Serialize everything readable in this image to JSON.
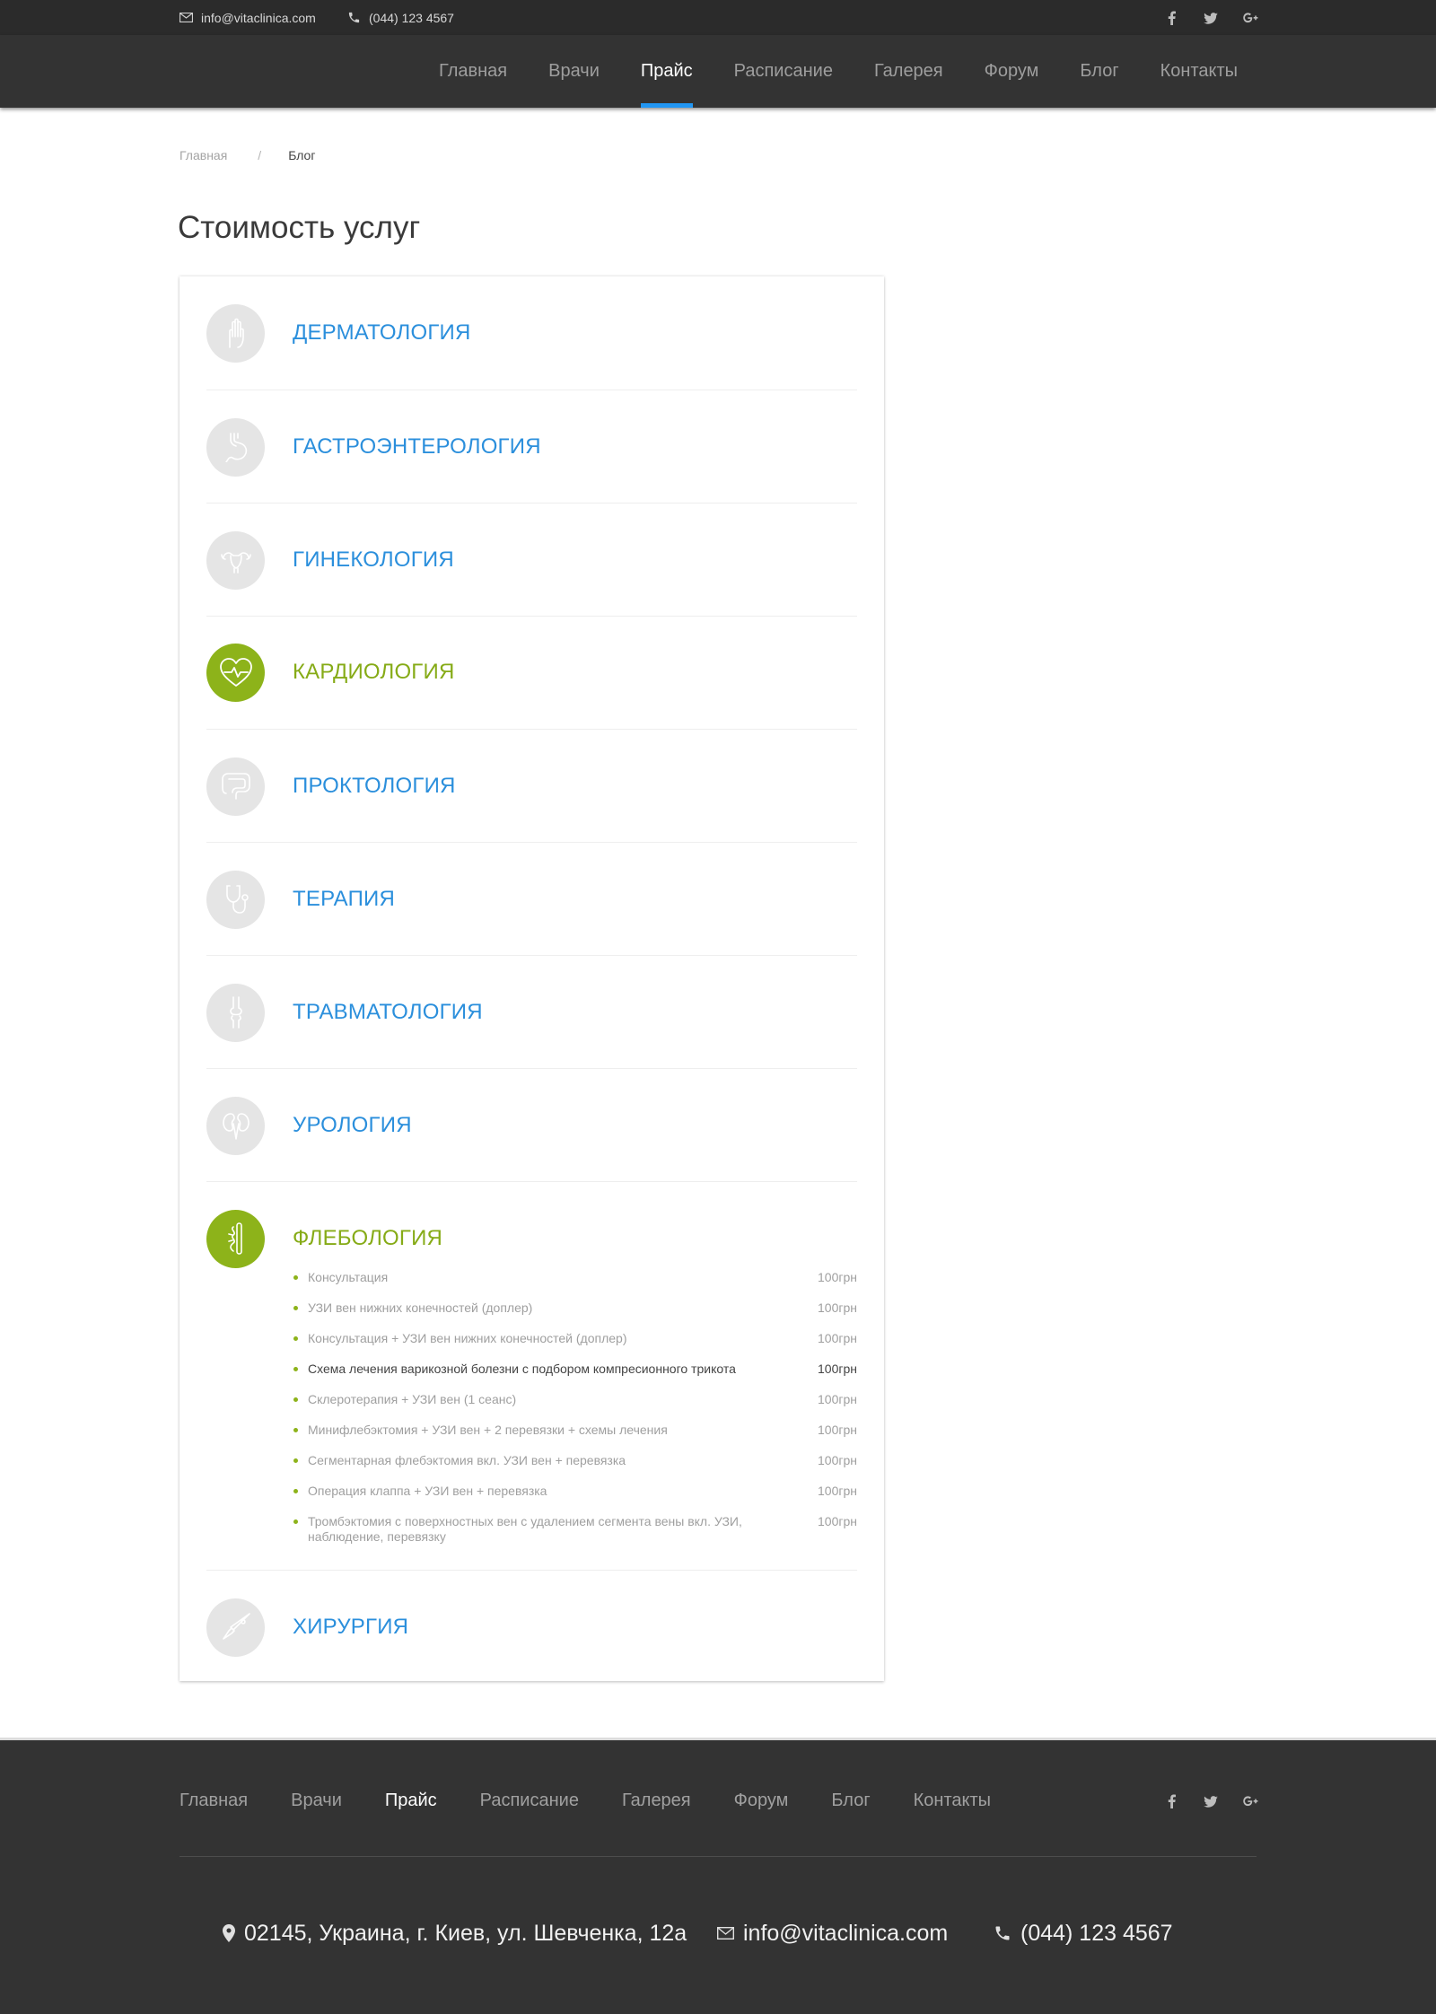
{
  "topbar": {
    "email": "info@vitaclinica.com",
    "phone": "(044) 123 4567",
    "social": [
      "facebook-icon",
      "twitter-icon",
      "google-plus-icon"
    ]
  },
  "nav": {
    "items": [
      {
        "label": "Главная"
      },
      {
        "label": "Врачи"
      },
      {
        "label": "Прайс",
        "active": true
      },
      {
        "label": "Расписание"
      },
      {
        "label": "Галерея"
      },
      {
        "label": "Форум"
      },
      {
        "label": "Блог"
      },
      {
        "label": "Контакты"
      }
    ]
  },
  "breadcrumb": {
    "home": "Главная",
    "separator": "/",
    "current": "Блог"
  },
  "page_title": "Стоимость услуг",
  "categories": [
    {
      "title": "ДЕРМАТОЛОГИЯ",
      "icon": "hand-icon"
    },
    {
      "title": "ГАСТРОЭНТЕРОЛОГИЯ",
      "icon": "stomach-icon"
    },
    {
      "title": "ГИНЕКОЛОГИЯ",
      "icon": "uterus-icon"
    },
    {
      "title": "КАРДИОЛОГИЯ",
      "icon": "heart-pulse-icon",
      "active": true
    },
    {
      "title": "ПРОКТОЛОГИЯ",
      "icon": "intestine-icon"
    },
    {
      "title": "ТЕРАПИЯ",
      "icon": "stethoscope-icon"
    },
    {
      "title": "ТРАВМАТОЛОГИЯ",
      "icon": "bone-joint-icon"
    },
    {
      "title": "УРОЛОГИЯ",
      "icon": "kidneys-icon"
    },
    {
      "title": "ФЛЕБОЛОГИЯ",
      "icon": "vein-icon",
      "active": true
    },
    {
      "title": "ХИРУРГИЯ",
      "icon": "scalpel-icon"
    }
  ],
  "phlebology_services": [
    {
      "name": "Консультация",
      "price": "100грн"
    },
    {
      "name": "УЗИ вен нижних конечностей (доплер)",
      "price": "100грн"
    },
    {
      "name": "Консультация + УЗИ вен нижних конечностей (доплер)",
      "price": "100грн"
    },
    {
      "name": "Схема лечения варикозной болезни с подбором компресионного трикота",
      "price": "100грн",
      "highlighted": true
    },
    {
      "name": "Склеротерапия + УЗИ вен (1 сеанс)",
      "price": "100грн"
    },
    {
      "name": "Минифлебэктомия + УЗИ вен + 2 перевязки + схемы лечения",
      "price": "100грн"
    },
    {
      "name": "Сегментарная флебэктомия вкл. УЗИ вен + перевязка",
      "price": "100грн"
    },
    {
      "name": "Операция клаппа + УЗИ вен + перевязка",
      "price": "100грн"
    },
    {
      "name": "Тромбэктомия с поверхностных вен с удалением сегмента вены вкл. УЗИ, наблюдение, перевязку",
      "price": "100грн"
    }
  ],
  "footer": {
    "nav": [
      {
        "label": "Главная"
      },
      {
        "label": "Врачи"
      },
      {
        "label": "Прайс",
        "active": true
      },
      {
        "label": "Расписание"
      },
      {
        "label": "Галерея"
      },
      {
        "label": "Форум"
      },
      {
        "label": "Блог"
      },
      {
        "label": "Контакты"
      }
    ],
    "address": "02145, Украина, г. Киев, ул. Шевченка, 12а",
    "email": "info@vitaclinica.com",
    "phone": "(044) 123 4567"
  },
  "colors": {
    "accent_blue": "#2196f3",
    "link_blue": "#2b8fdc",
    "active_green": "#8db31a",
    "dark_bg": "#333333"
  }
}
